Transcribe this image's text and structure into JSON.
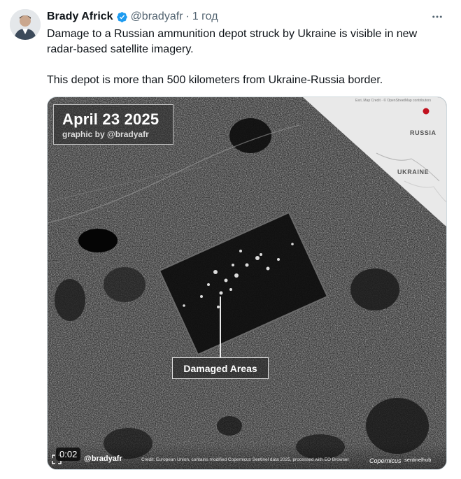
{
  "tweet": {
    "author_name": "Brady Africk",
    "handle": "@bradyafr",
    "separator": "·",
    "time": "1 год",
    "verified_icon": "verified-badge-icon",
    "more_icon": "more-dots-icon",
    "text_paragraph_1": "Damage to a Russian ammunition depot struck by Ukraine is visible in new radar-based satellite imagery.",
    "text_paragraph_2": "This depot is more than 500 kilometers from Ukraine-Russia border."
  },
  "media": {
    "date_title": "April 23 2025",
    "date_subtitle": "graphic by @bradyafr",
    "map_credit": "Esri, Map Credit · © OpenStreetMap contributors",
    "map_label_russia": "RUSSIA",
    "map_label_ukraine": "UKRAINE",
    "callout": "Damaged Areas",
    "timecode": "0:02",
    "watermark_handle": "@bradyafr",
    "credit": "Credit: European Union, contains modified Copernicus Sentinel data 2025, processed with EO Browser",
    "copernicus_logo": "Copernicus",
    "sentinelhub_logo": "sentinelhub",
    "accent_marker_color": "#c1121f"
  },
  "colors": {
    "verified_blue": "#1d9bf0",
    "secondary_text": "#536471"
  }
}
